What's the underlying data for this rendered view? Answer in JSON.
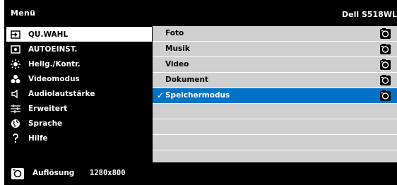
{
  "header": {
    "title": "Menü",
    "model": "Dell S518WL"
  },
  "sidebar": {
    "items": [
      {
        "label": "QU.WAHL",
        "icon": "input-source-icon"
      },
      {
        "label": "AUTOEINST.",
        "icon": "auto-adjust-icon"
      },
      {
        "label": "Hellg./Kontr.",
        "icon": "brightness-icon"
      },
      {
        "label": "Videomodus",
        "icon": "video-mode-icon"
      },
      {
        "label": "Audiolautstärke",
        "icon": "speaker-icon"
      },
      {
        "label": "Erweitert",
        "icon": "advanced-settings-icon"
      },
      {
        "label": "Sprache",
        "icon": "globe-icon"
      },
      {
        "label": "Hilfe",
        "icon": "help-icon"
      }
    ]
  },
  "panel": {
    "items": [
      {
        "label": "Foto",
        "icon": "camera-icon"
      },
      {
        "label": "Musik",
        "icon": "camera-icon"
      },
      {
        "label": "Video",
        "icon": "camera-icon"
      },
      {
        "label": "Dokument",
        "icon": "camera-icon"
      },
      {
        "label": "Speichermodus",
        "icon": "camera-icon",
        "checked": true
      }
    ]
  },
  "footer": {
    "label": "Auflösung",
    "value": "1280x800",
    "icon": "camera-icon"
  },
  "colors": {
    "background": "#000000",
    "panel": "#cfcfcf",
    "selected_row": "#0073c7",
    "selected_sidebar": "#ffffff"
  }
}
